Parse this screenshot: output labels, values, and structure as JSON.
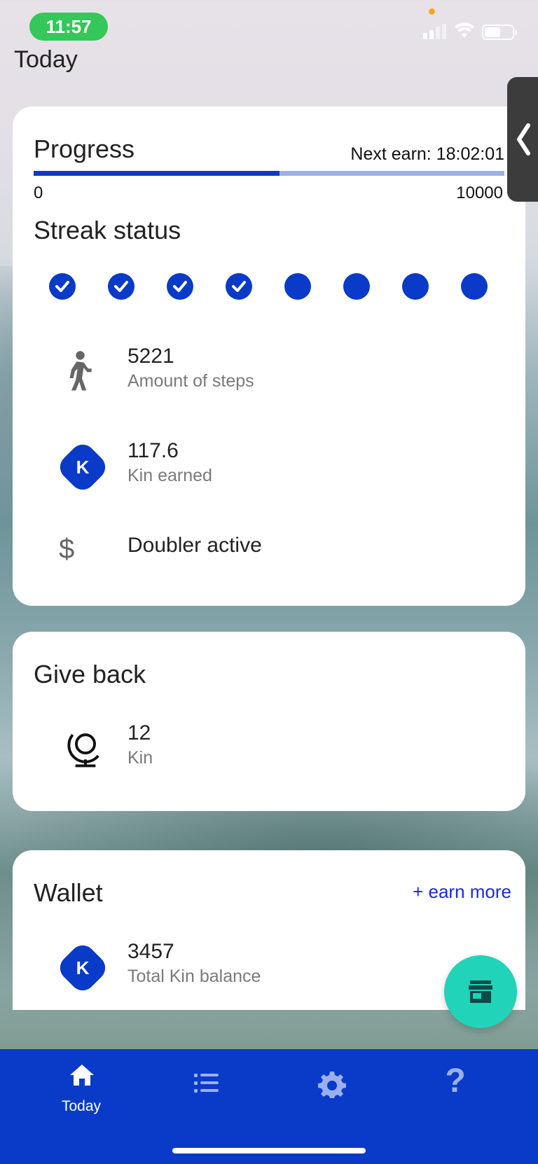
{
  "status_bar": {
    "time": "11:57"
  },
  "screen": {
    "title": "Today"
  },
  "progress_card": {
    "heading": "Progress",
    "next_earn": "Next earn: 18:02:01",
    "bar_min": "0",
    "bar_max": "10000",
    "progress_fraction": 0.522,
    "streak_heading": "Streak status",
    "streak": [
      true,
      true,
      true,
      true,
      false,
      false,
      false,
      false
    ],
    "steps": {
      "value": "5221",
      "label": "Amount of steps",
      "icon": "walk-icon"
    },
    "kin_earned": {
      "value": "117.6",
      "label": "Kin earned",
      "icon": "kin-icon"
    },
    "doubler": {
      "label": "Doubler active",
      "icon": "dollar-icon"
    }
  },
  "giveback_card": {
    "heading": "Give back",
    "value": "12",
    "label": "Kin",
    "icon": "globe-icon"
  },
  "wallet_card": {
    "heading": "Wallet",
    "earn_more": "+ earn more",
    "value": "3457",
    "label": "Total Kin balance",
    "icon": "kin-icon"
  },
  "fab": {
    "icon": "store-icon"
  },
  "nav": {
    "items": [
      {
        "label": "Today",
        "icon": "home-icon"
      },
      {
        "label": "",
        "icon": "list-icon"
      },
      {
        "label": "",
        "icon": "gear-icon"
      },
      {
        "label": "",
        "icon": "help-icon"
      }
    ]
  },
  "colors": {
    "primary": "#0a3ac8",
    "fab": "#21d3b8",
    "time_pill": "#34c759",
    "link": "#1a2ad8"
  }
}
